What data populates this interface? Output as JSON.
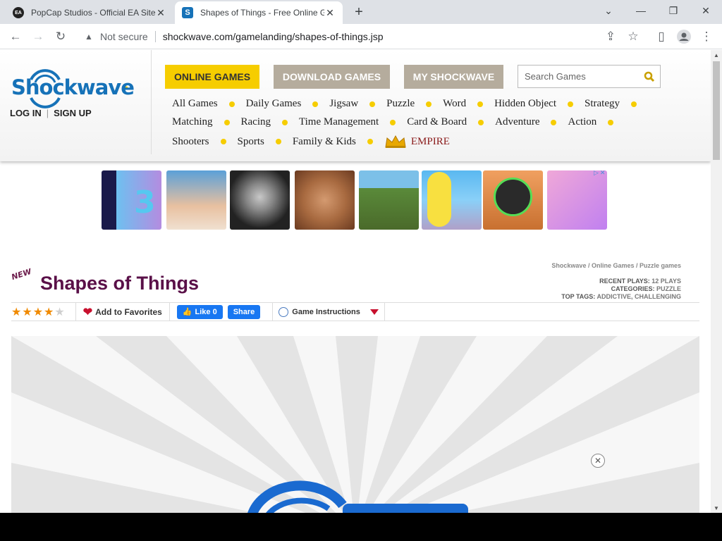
{
  "browser": {
    "tabs": [
      {
        "title": "PopCap Studios - Official EA Site",
        "favicon": "EA"
      },
      {
        "title": "Shapes of Things - Free Online G",
        "favicon": "S"
      }
    ],
    "not_secure_label": "Not secure",
    "url": "shockwave.com/gamelanding/shapes-of-things.jsp"
  },
  "site": {
    "logo_text": "Shockwave",
    "login_label": "LOG IN",
    "signup_label": "SIGN UP",
    "top_buttons": {
      "online": "ONLINE GAMES",
      "download": "DOWNLOAD GAMES",
      "my": "MY SHOCKWAVE"
    },
    "search_placeholder": "Search Games",
    "nav_row1": [
      "All Games",
      "Daily Games",
      "Jigsaw",
      "Puzzle",
      "Word",
      "Hidden Object",
      "Strategy"
    ],
    "nav_row2": [
      "Matching",
      "Racing",
      "Time Management",
      "Card & Board",
      "Adventure",
      "Action"
    ],
    "nav_row3": [
      "Shooters",
      "Sports",
      "Family & Kids"
    ],
    "empire_label": "EMPIRE"
  },
  "game": {
    "new_badge": "NEW",
    "title": "Shapes of Things",
    "breadcrumb": "Shockwave / Online Games / Puzzle games",
    "recent_plays_label": "RECENT PLAYS:",
    "recent_plays_value": "12 PLAYS",
    "categories_label": "CATEGORIES:",
    "categories_value": "PUZZLE",
    "top_tags_label": "TOP TAGS:",
    "top_tags_value": "ADDICTIVE, CHALLENGING",
    "rating": 4,
    "rating_max": 5,
    "add_favorites": "Add to Favorites",
    "like_label": "Like 0",
    "share_label": "Share",
    "instructions_label": "Game Instructions"
  },
  "colors": {
    "accent_yellow": "#f6cd00",
    "title_purple": "#5a1048",
    "logo_blue": "#1672b8"
  }
}
